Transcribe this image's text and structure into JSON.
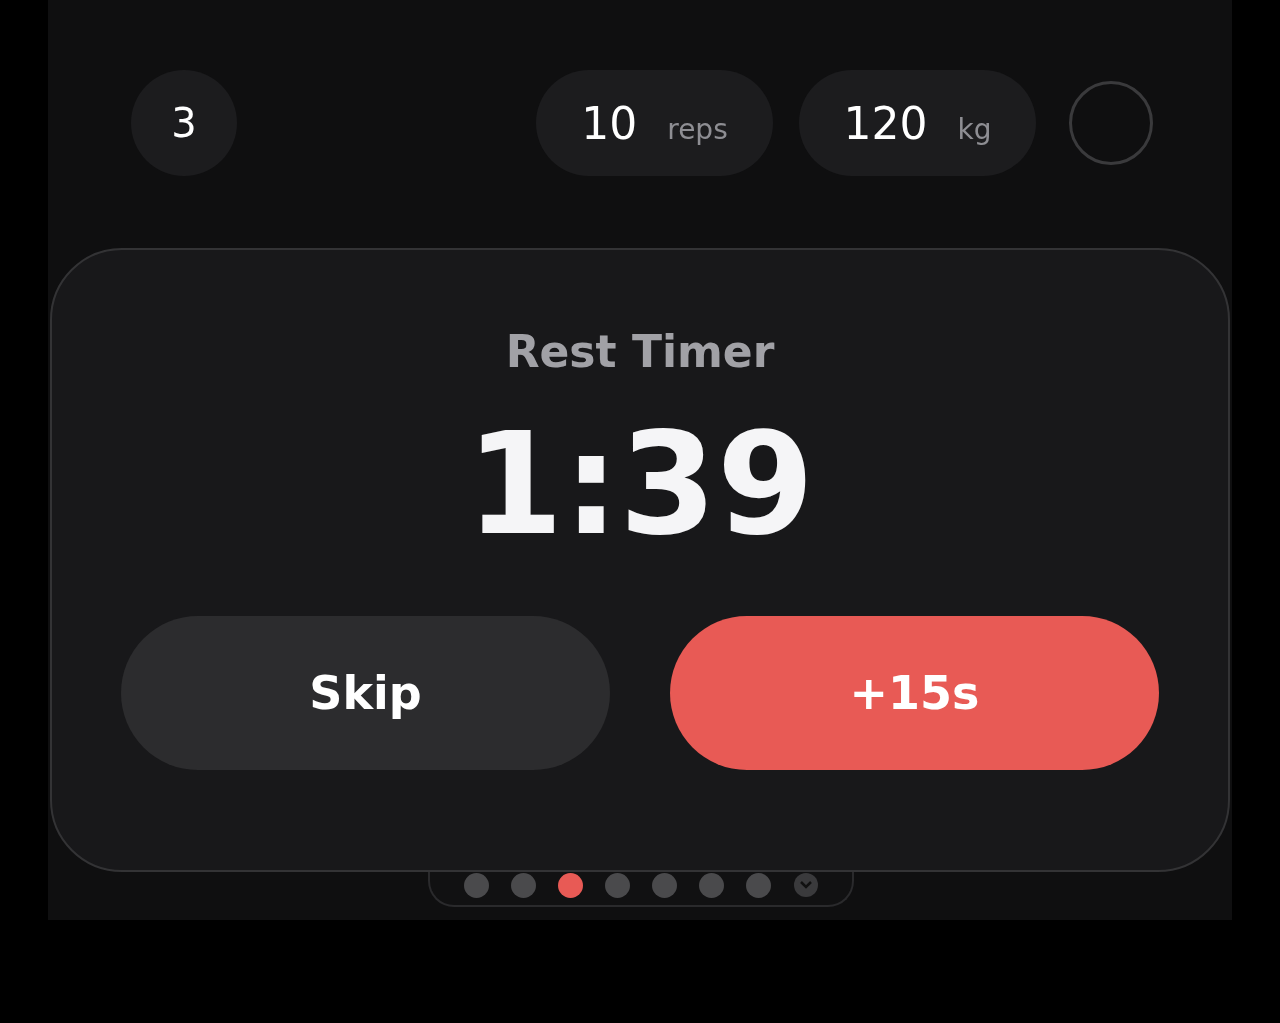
{
  "set_row": {
    "set_number": "3",
    "reps": {
      "value": "10",
      "unit": "reps"
    },
    "weight": {
      "value": "120",
      "unit": "kg"
    },
    "completed": false
  },
  "rest_timer": {
    "title": "Rest Timer",
    "time": "1:39",
    "buttons": [
      {
        "label": "Skip",
        "kind": "secondary"
      },
      {
        "label": "+15s",
        "kind": "primary"
      }
    ]
  },
  "page_dots": [
    {
      "kind": "dot",
      "selected": false
    },
    {
      "kind": "dot",
      "selected": false
    },
    {
      "kind": "dot",
      "selected": true
    },
    {
      "kind": "dot",
      "selected": false
    },
    {
      "kind": "dot",
      "selected": false
    },
    {
      "kind": "dot",
      "selected": false
    },
    {
      "kind": "dot",
      "selected": false
    },
    {
      "kind": "badge",
      "selected": false
    }
  ]
}
